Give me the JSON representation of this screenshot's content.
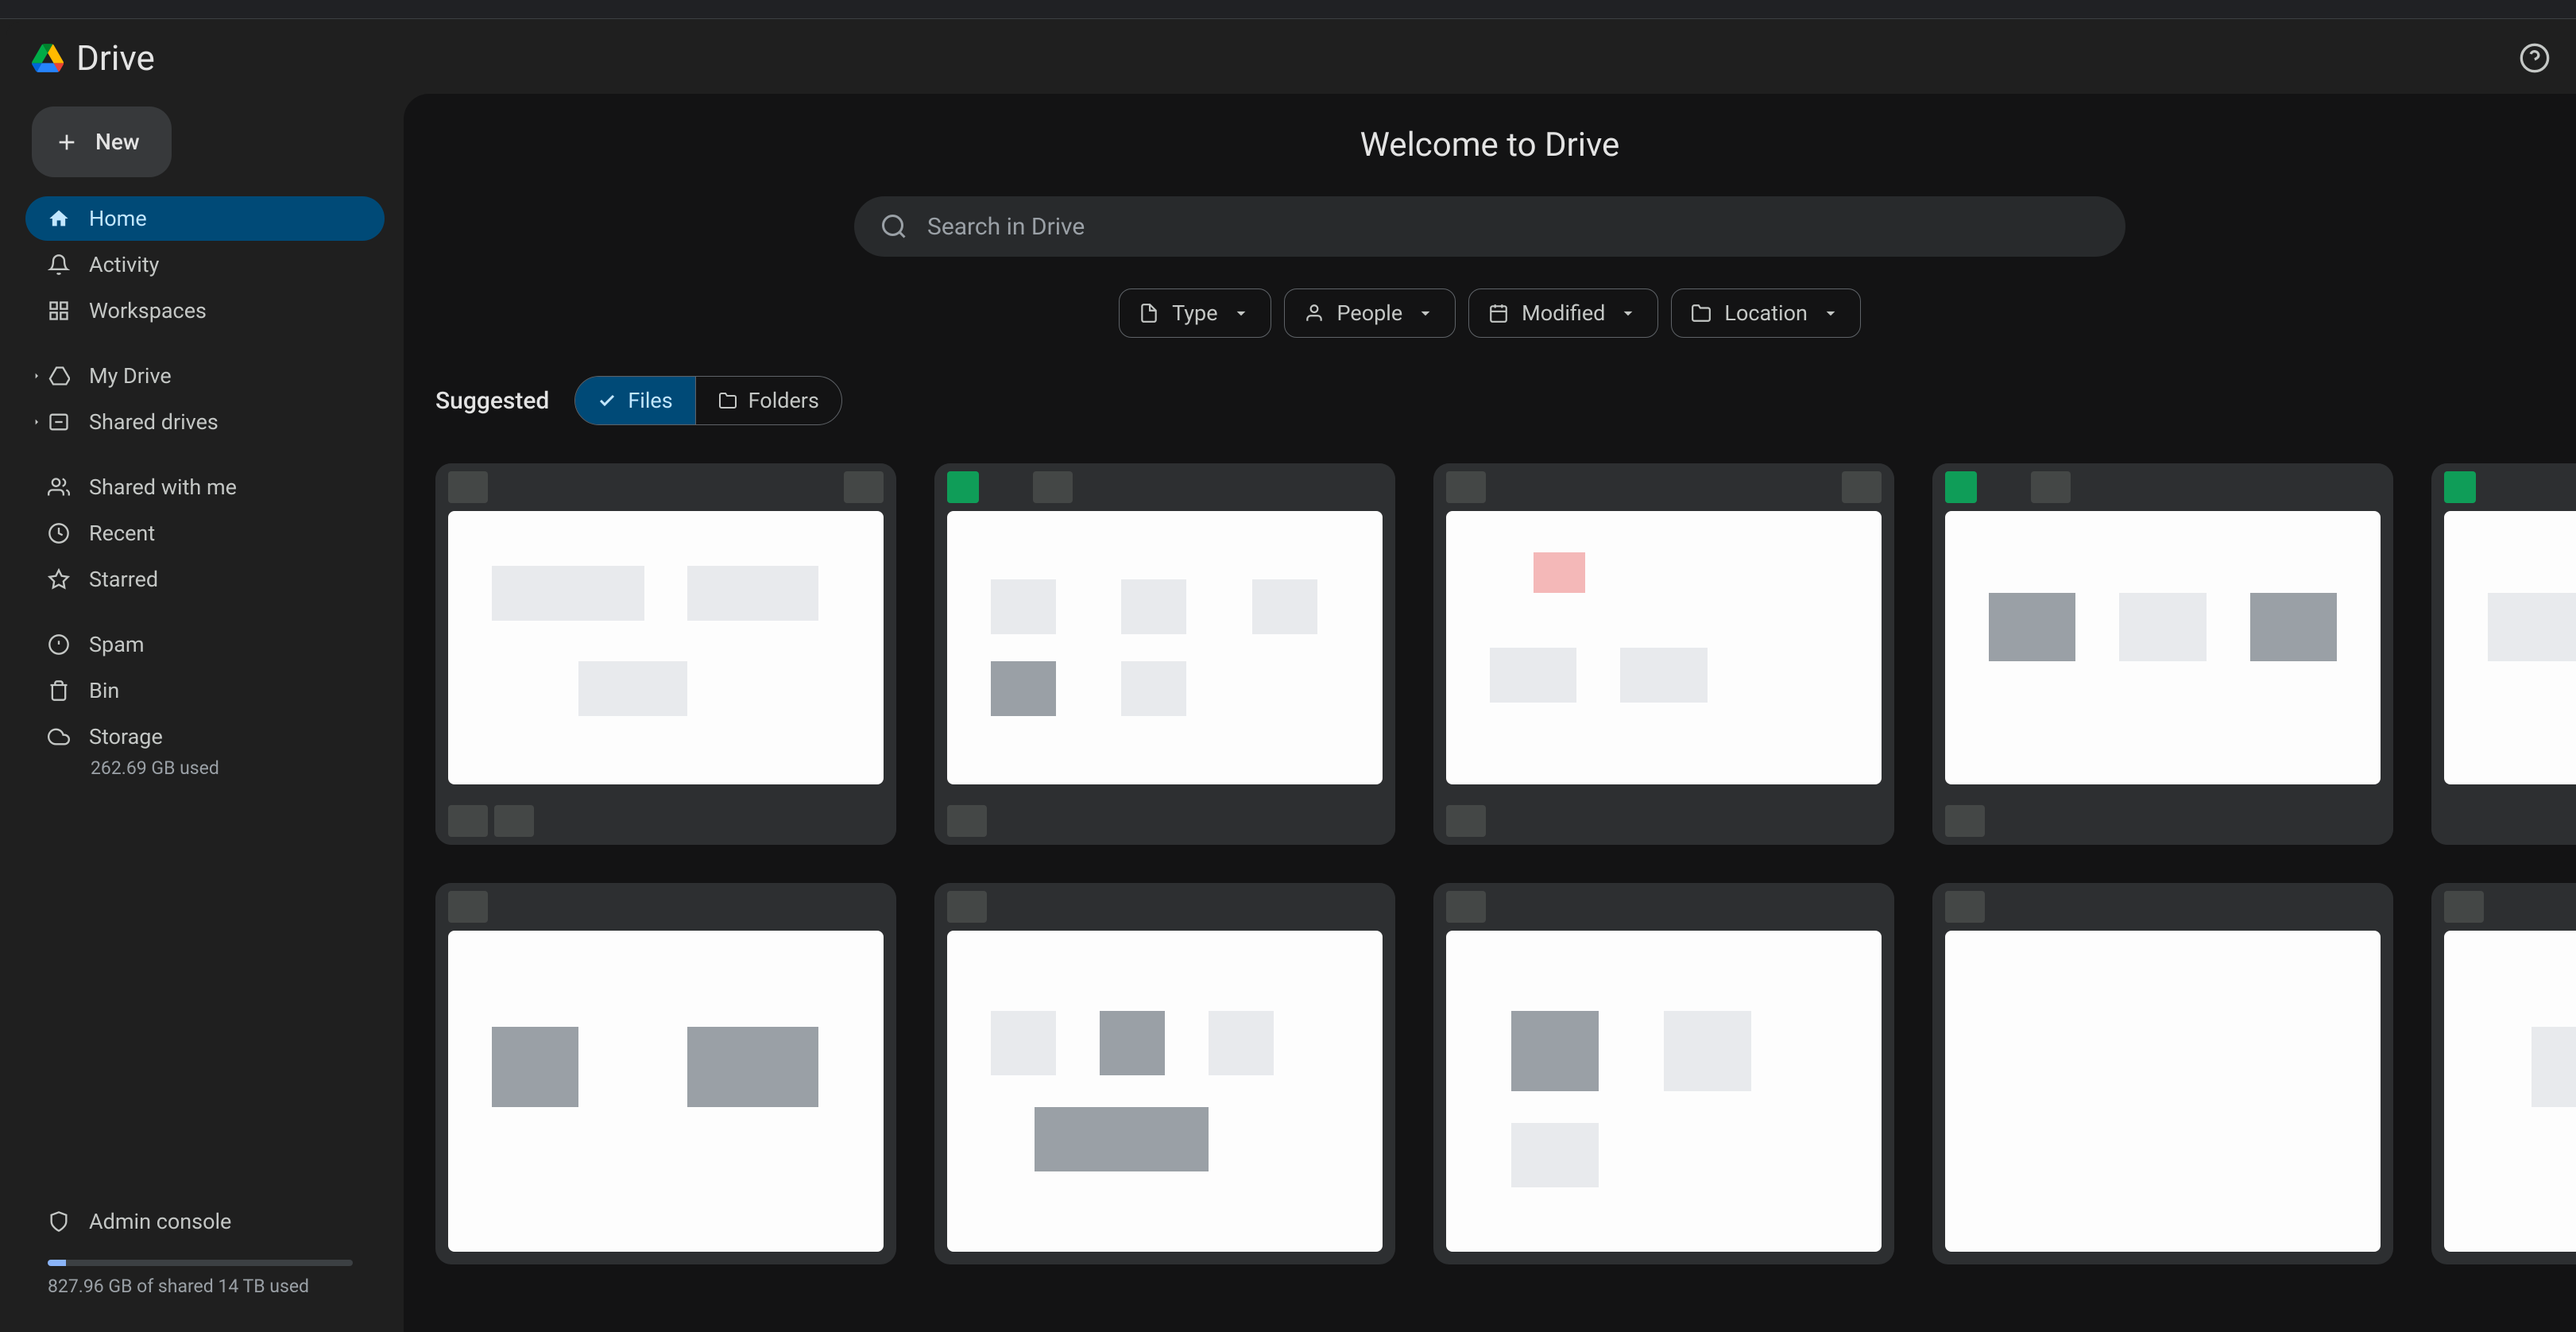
{
  "app": {
    "name": "Drive"
  },
  "header": {
    "welcome": "Welcome to Drive"
  },
  "search": {
    "placeholder": "Search in Drive"
  },
  "sidebar": {
    "new_label": "New",
    "items": {
      "home": "Home",
      "activity": "Activity",
      "workspaces": "Workspaces",
      "mydrive": "My Drive",
      "shareddrives": "Shared drives",
      "sharedwithme": "Shared with me",
      "recent": "Recent",
      "starred": "Starred",
      "spam": "Spam",
      "bin": "Bin",
      "storage": "Storage"
    },
    "storage_used": "262.69 GB used",
    "admin": "Admin console",
    "shared_storage": "827.96 GB of shared 14 TB used"
  },
  "filters": {
    "type": "Type",
    "people": "People",
    "modified": "Modified",
    "location": "Location"
  },
  "suggested": {
    "label": "Suggested",
    "files": "Files",
    "folders": "Folders"
  }
}
